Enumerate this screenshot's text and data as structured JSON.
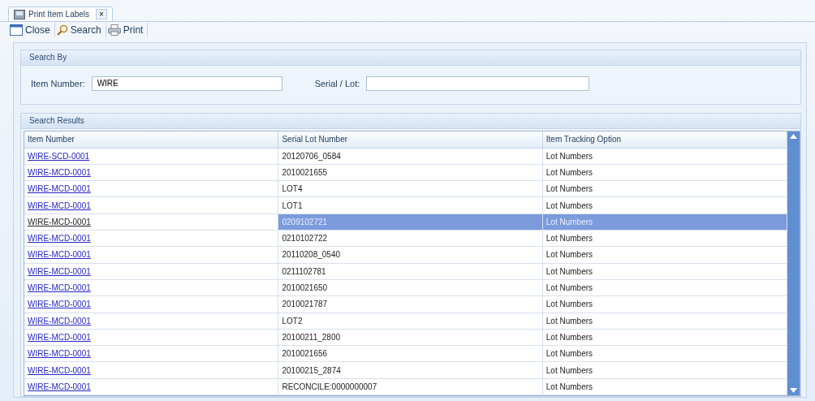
{
  "tabs": [
    {
      "label": "Print Item Labels",
      "selected": true,
      "close": "×"
    }
  ],
  "toolbar": [
    {
      "kind": "close",
      "label": "Close"
    },
    {
      "kind": "search",
      "label": "Search"
    },
    {
      "kind": "print",
      "label": "Print"
    }
  ],
  "search_by": {
    "title": "Search By",
    "fields": [
      {
        "label": "Item Number:",
        "value": "WIRE"
      },
      {
        "label": "Serial / Lot:"
      }
    ]
  },
  "results": {
    "title": "Search Results",
    "columns": [
      "Item Number",
      "Serial Lot Number",
      "Item Tracking Option"
    ],
    "rows": [
      {
        "item": "WIRE-SCD-0001",
        "serial": "20120706_0584",
        "tracking": "Lot Numbers",
        "selected": false
      },
      {
        "item": "WIRE-MCD-0001",
        "serial": "2010021655",
        "tracking": "Lot Numbers",
        "selected": false
      },
      {
        "item": "WIRE-MCD-0001",
        "serial": "LOT4",
        "tracking": "Lot Numbers",
        "selected": false
      },
      {
        "item": "WIRE-MCD-0001",
        "serial": "LOT1",
        "tracking": "Lot Numbers",
        "selected": false
      },
      {
        "item": "WIRE-MCD-0001",
        "serial": "0209102721",
        "tracking": "Lot Numbers",
        "selected": true
      },
      {
        "item": "WIRE-MCD-0001",
        "serial": "0210102722",
        "tracking": "Lot Numbers",
        "selected": false
      },
      {
        "item": "WIRE-MCD-0001",
        "serial": "20110208_0540",
        "tracking": "Lot Numbers",
        "selected": false
      },
      {
        "item": "WIRE-MCD-0001",
        "serial": "0211102781",
        "tracking": "Lot Numbers",
        "selected": false
      },
      {
        "item": "WIRE-MCD-0001",
        "serial": "2010021650",
        "tracking": "Lot Numbers",
        "selected": false
      },
      {
        "item": "WIRE-MCD-0001",
        "serial": "2010021787",
        "tracking": "Lot Numbers",
        "selected": false
      },
      {
        "item": "WIRE-MCD-0001",
        "serial": "LOT2",
        "tracking": "Lot Numbers",
        "selected": false
      },
      {
        "item": "WIRE-MCD-0001",
        "serial": "20100211_2800",
        "tracking": "Lot Numbers",
        "selected": false
      },
      {
        "item": "WIRE-MCD-0001",
        "serial": "2010021656",
        "tracking": "Lot Numbers",
        "selected": false
      },
      {
        "item": "WIRE-MCD-0001",
        "serial": "20100215_2874",
        "tracking": "Lot Numbers",
        "selected": false
      },
      {
        "item": "WIRE-MCD-0001",
        "serial": "RECONCILE:0000000007",
        "tracking": "Lot Numbers",
        "selected": false
      }
    ]
  }
}
